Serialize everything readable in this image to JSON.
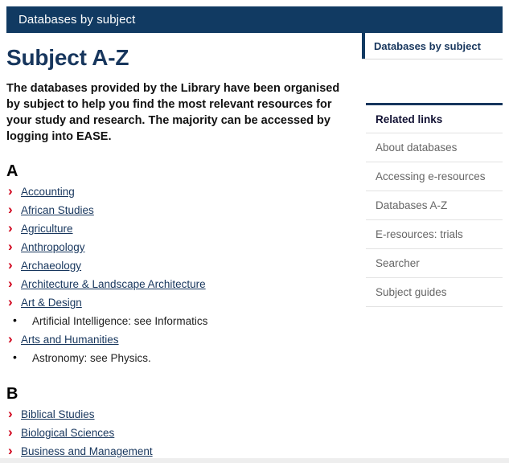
{
  "banner": {
    "title": "Databases by subject"
  },
  "main": {
    "page_title": "Subject A-Z",
    "intro": "The databases provided by the Library have been organised by subject to help you find the most relevant resources for your study and research. The majority can be accessed by logging into EASE.",
    "sections": [
      {
        "letter": "A",
        "items": [
          {
            "label": "Accounting",
            "type": "link"
          },
          {
            "label": "African Studies",
            "type": "link"
          },
          {
            "label": "Agriculture",
            "type": "link"
          },
          {
            "label": "Anthropology",
            "type": "link"
          },
          {
            "label": "Archaeology",
            "type": "link"
          },
          {
            "label": "Architecture & Landscape Architecture",
            "type": "link"
          },
          {
            "label": "Art & Design",
            "type": "link"
          },
          {
            "label": "Artificial Intelligence: see Informatics",
            "type": "plain"
          },
          {
            "label": "Arts and Humanities",
            "type": "link"
          },
          {
            "label": "Astronomy: see Physics.",
            "type": "plain"
          }
        ]
      },
      {
        "letter": "B",
        "items": [
          {
            "label": "Biblical Studies",
            "type": "link"
          },
          {
            "label": "Biological Sciences",
            "type": "link"
          },
          {
            "label": "Business and Management",
            "type": "link"
          }
        ]
      }
    ]
  },
  "sidebar": {
    "tab": {
      "label": "Databases by subject"
    },
    "related_links": {
      "heading": "Related links",
      "items": [
        {
          "label": "About databases"
        },
        {
          "label": "Accessing e-resources"
        },
        {
          "label": "Databases A-Z"
        },
        {
          "label": "E-resources: trials"
        },
        {
          "label": "Searcher"
        },
        {
          "label": "Subject guides"
        }
      ]
    }
  },
  "colors": {
    "banner_bg": "#113a62",
    "heading_navy": "#17365d",
    "chevron_red": "#d0021b",
    "sidebar_text": "#666666",
    "divider": "#e2e2e2"
  }
}
